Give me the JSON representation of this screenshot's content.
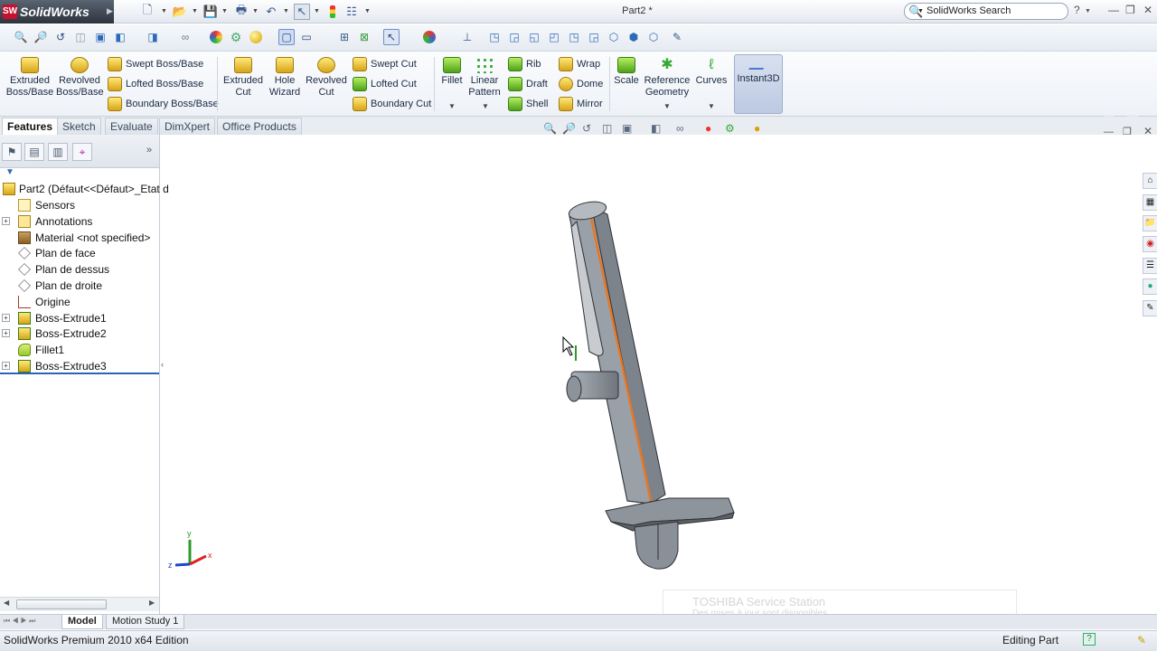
{
  "app": {
    "name": "SolidWorks",
    "document_title": "Part2 *"
  },
  "search": {
    "label": "SolidWorks Search"
  },
  "command_manager": {
    "extruded_boss": "Extruded Boss/Base",
    "revolved_boss": "Revolved Boss/Base",
    "swept_boss": "Swept Boss/Base",
    "lofted_boss": "Lofted Boss/Base",
    "boundary_boss": "Boundary Boss/Base",
    "extruded_cut": "Extruded Cut",
    "hole_wizard": "Hole Wizard",
    "revolved_cut": "Revolved Cut",
    "swept_cut": "Swept Cut",
    "lofted_cut": "Lofted Cut",
    "boundary_cut": "Boundary Cut",
    "fillet": "Fillet",
    "linear_pattern": "Linear Pattern",
    "rib": "Rib",
    "draft": "Draft",
    "shell": "Shell",
    "wrap": "Wrap",
    "dome": "Dome",
    "mirror": "Mirror",
    "scale": "Scale",
    "reference_geometry": "Reference Geometry",
    "curves": "Curves",
    "instant3d": "Instant3D"
  },
  "tabs": [
    "Features",
    "Sketch",
    "Evaluate",
    "DimXpert",
    "Office Products"
  ],
  "feature_tree": {
    "root": "Part2  (Défaut<<Défaut>_Etat d",
    "items": [
      {
        "label": "Sensors",
        "icon": "sensor-icon",
        "expandable": false
      },
      {
        "label": "Annotations",
        "icon": "annotation-icon",
        "expandable": true
      },
      {
        "label": "Material <not specified>",
        "icon": "material-icon",
        "expandable": false
      },
      {
        "label": "Plan de face",
        "icon": "plane-icon",
        "expandable": false
      },
      {
        "label": "Plan de dessus",
        "icon": "plane-icon",
        "expandable": false
      },
      {
        "label": "Plan de droite",
        "icon": "plane-icon",
        "expandable": false
      },
      {
        "label": "Origine",
        "icon": "origin-icon",
        "expandable": false
      },
      {
        "label": "Boss-Extrude1",
        "icon": "extrude-icon",
        "expandable": true
      },
      {
        "label": "Boss-Extrude2",
        "icon": "extrude-icon",
        "expandable": true
      },
      {
        "label": "Fillet1",
        "icon": "fillet-icon",
        "expandable": false
      },
      {
        "label": "Boss-Extrude3",
        "icon": "extrude-icon",
        "expandable": true
      }
    ]
  },
  "bottom_tabs": [
    "Model",
    "Motion Study 1"
  ],
  "status": {
    "left": "SolidWorks Premium 2010 x64 Edition",
    "right": "Editing Part"
  },
  "triad": {
    "x": "x",
    "y": "y",
    "z": "z"
  },
  "notification": {
    "line1": "TOSHIBA Service Station",
    "line2": "Des mises à jour sont disponibles"
  },
  "colors": {
    "accent": "#2b63b8",
    "model_body": "#8e939a",
    "model_edge": "#e87722"
  }
}
